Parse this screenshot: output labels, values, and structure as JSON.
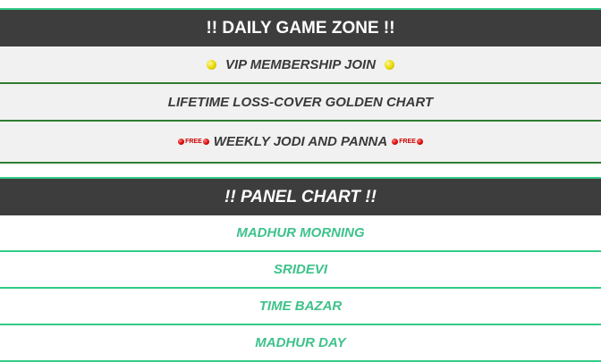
{
  "game_zone": {
    "title": "!! DAILY GAME ZONE !!",
    "links": [
      {
        "label": "VIP MEMBERSHIP JOIN"
      },
      {
        "label": "LIFETIME LOSS-COVER GOLDEN CHART"
      },
      {
        "label": "WEEKLY JODI AND PANNA",
        "badge": "FREE"
      }
    ]
  },
  "panel_chart": {
    "title": "!! PANEL CHART !!",
    "links": [
      {
        "label": "MADHUR MORNING"
      },
      {
        "label": "SRIDEVI"
      },
      {
        "label": "TIME BAZAR"
      },
      {
        "label": "MADHUR DAY"
      }
    ]
  },
  "colors": {
    "header_bg": "#3d3d3d",
    "panel_link": "#3ec28a",
    "zone_border": "#2f7d32"
  }
}
